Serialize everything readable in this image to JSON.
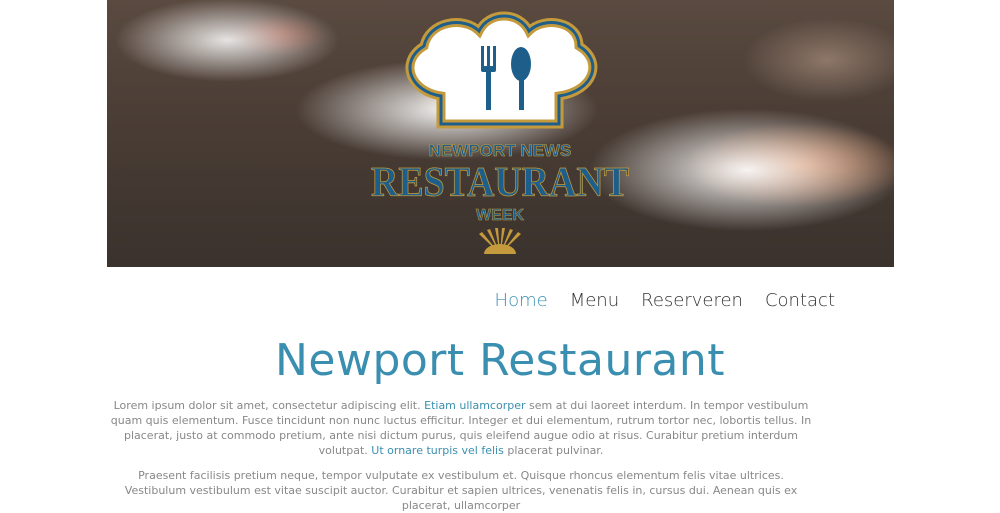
{
  "hero": {
    "logo": {
      "line1": "NEWPORT NEWS",
      "line2": "RESTAURANT",
      "line3": "WEEK",
      "colors": {
        "blue": "#1d5f8a",
        "gold": "#c49a3c"
      }
    }
  },
  "nav": {
    "items": [
      {
        "label": "Home",
        "active": true
      },
      {
        "label": "Menu",
        "active": false
      },
      {
        "label": "Reserveren",
        "active": false
      },
      {
        "label": "Contact",
        "active": false
      }
    ]
  },
  "main": {
    "title": "Newport Restaurant",
    "paragraph1": {
      "text_a": "Lorem ipsum dolor sit amet, consectetur adipiscing elit. ",
      "link1": "Etiam ullamcorper",
      "text_b": " sem at dui laoreet interdum. In tempor vestibulum quam quis elementum. Fusce tincidunt non nunc luctus efficitur. Integer et dui elementum, rutrum tortor nec, lobortis tellus. In placerat, justo at commodo pretium, ante nisi dictum purus, quis eleifend augue odio at risus. Curabitur pretium interdum volutpat. ",
      "link2": "Ut ornare turpis vel felis",
      "text_c": " placerat pulvinar."
    },
    "paragraph2": {
      "text": "Praesent facilisis pretium neque, tempor vulputate ex vestibulum et. Quisque rhoncus elementum felis vitae ultrices. Vestibulum vestibulum est vitae suscipit auctor. Curabitur et sapien ultrices, venenatis felis in, cursus dui. Aenean quis ex placerat, ullamcorper"
    }
  },
  "colors": {
    "accent": "#3a8fb0",
    "nav_text": "#333333",
    "body_text": "#888888"
  }
}
